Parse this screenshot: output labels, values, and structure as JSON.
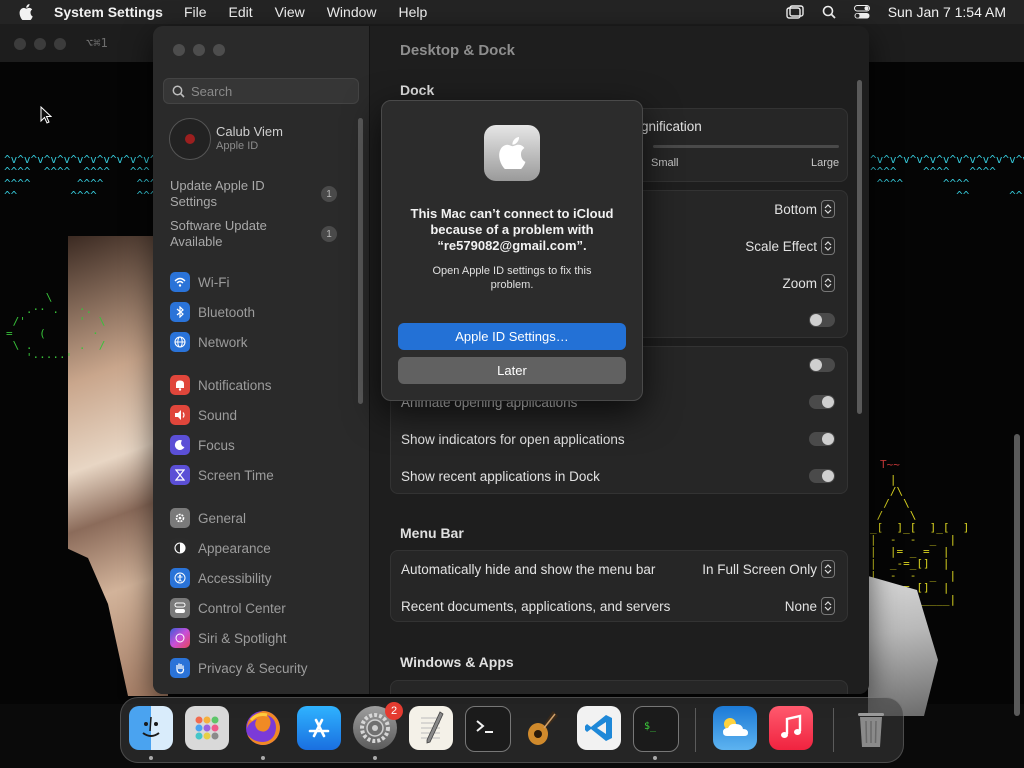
{
  "menubar": {
    "app_name": "System Settings",
    "menus": [
      "File",
      "Edit",
      "View",
      "Window",
      "Help"
    ],
    "datetime": "Sun Jan 7  1:54 AM"
  },
  "terminal": {
    "title": "⌥⌘1"
  },
  "sidebar": {
    "search_placeholder": "Search",
    "user": {
      "name": "Calub Viem",
      "subtitle": "Apple ID"
    },
    "notices": [
      {
        "label": "Update Apple ID Settings",
        "count": "1"
      },
      {
        "label": "Software Update Available",
        "count": "1"
      }
    ],
    "items": [
      {
        "label": "Wi-Fi",
        "icon": "wifi-icon",
        "color": "#2a73d8"
      },
      {
        "label": "Bluetooth",
        "icon": "bluetooth-icon",
        "color": "#2a73d8"
      },
      {
        "label": "Network",
        "icon": "globe-icon",
        "color": "#2a73d8"
      },
      {
        "label": "Notifications",
        "icon": "bell-icon",
        "color": "#e0463b"
      },
      {
        "label": "Sound",
        "icon": "speaker-icon",
        "color": "#e0463b"
      },
      {
        "label": "Focus",
        "icon": "moon-icon",
        "color": "#5b4fd6"
      },
      {
        "label": "Screen Time",
        "icon": "hourglass-icon",
        "color": "#5b4fd6"
      },
      {
        "label": "General",
        "icon": "gear-icon",
        "color": "#7a7a7a"
      },
      {
        "label": "Appearance",
        "icon": "appearance-icon",
        "color": "#2b2b2b"
      },
      {
        "label": "Accessibility",
        "icon": "accessibility-icon",
        "color": "#2a73d8"
      },
      {
        "label": "Control Center",
        "icon": "control-center-icon",
        "color": "#7a7a7a"
      },
      {
        "label": "Siri & Spotlight",
        "icon": "siri-icon",
        "color": "#b04cd8"
      },
      {
        "label": "Privacy & Security",
        "icon": "hand-icon",
        "color": "#2a73d8"
      }
    ]
  },
  "content": {
    "title": "Desktop & Dock",
    "dock_section": "Dock",
    "magnification_label": "gnification",
    "size_small": "Small",
    "size_large": "Large",
    "position_value": "Bottom",
    "minimize_value": "Scale Effect",
    "double_click_value": "Zoom",
    "animate_label": "Animate opening applications",
    "indicators_label": "Show indicators for open applications",
    "recent_label": "Show recent applications in Dock",
    "menubar_section": "Menu Bar",
    "autohide_label": "Automatically hide and show the menu bar",
    "autohide_value": "In Full Screen Only",
    "recent_docs_label": "Recent documents, applications, and servers",
    "recent_docs_value": "None",
    "windows_section": "Windows & Apps"
  },
  "alert": {
    "title": "This Mac can’t connect to iCloud because of a problem with “re579082@gmail.com”.",
    "message": "Open Apple ID settings to fix this problem.",
    "primary_button": "Apple ID Settings…",
    "secondary_button": "Later"
  },
  "dock": {
    "badge_count": "2",
    "apps": [
      "Finder",
      "Launchpad",
      "Firefox",
      "App Store",
      "System Settings",
      "TextEdit",
      "Terminal",
      "GarageBand",
      "Visual Studio Code",
      "Terminal",
      "Weather",
      "Music",
      "Trash"
    ]
  }
}
